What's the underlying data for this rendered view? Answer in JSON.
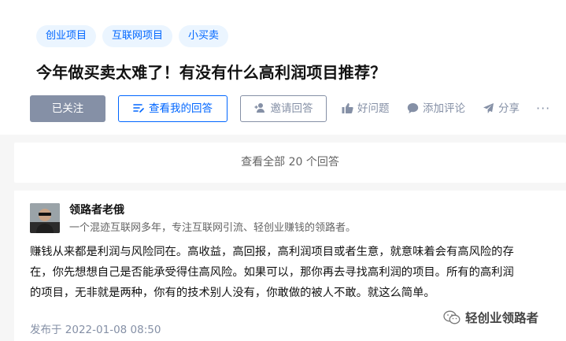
{
  "question": {
    "tags": [
      "创业项目",
      "互联网项目",
      "小买卖"
    ],
    "title": "今年做买卖太难了！有没有什么高利润项目推荐？"
  },
  "actions": {
    "followed": "已关注",
    "view_my_answer": "查看我的回答",
    "invite": "邀请回答",
    "good_question": "好问题",
    "comment": "添加评论",
    "share": "分享",
    "more": "···"
  },
  "view_all": {
    "label": "查看全部 20 个回答"
  },
  "answer": {
    "author_name": "领路者老俄",
    "author_bio": "一个混迹互联网多年，专注互联网引流、轻创业赚钱的领路者。",
    "lines": [
      "赚钱从来都是利润与风险同在。高收益，高回报，高利润项目或者生意，就意味着会有高风险的存",
      "在，你先想想自己是否能承受得住高风险。如果可以，那你再去寻找高利润的项目。所有的高利润",
      "的项目，无非就是两种，你有的技术别人没有，你敢做的被人不敢。就这么简单。"
    ],
    "published": "发布于 2022-01-08 08:50"
  },
  "watermark": {
    "text": "轻创业领路者",
    "icon": "wechat-icon"
  },
  "colors": {
    "accent": "#0066ff",
    "tag_bg": "#ebf5ff",
    "muted": "#8590a6"
  }
}
